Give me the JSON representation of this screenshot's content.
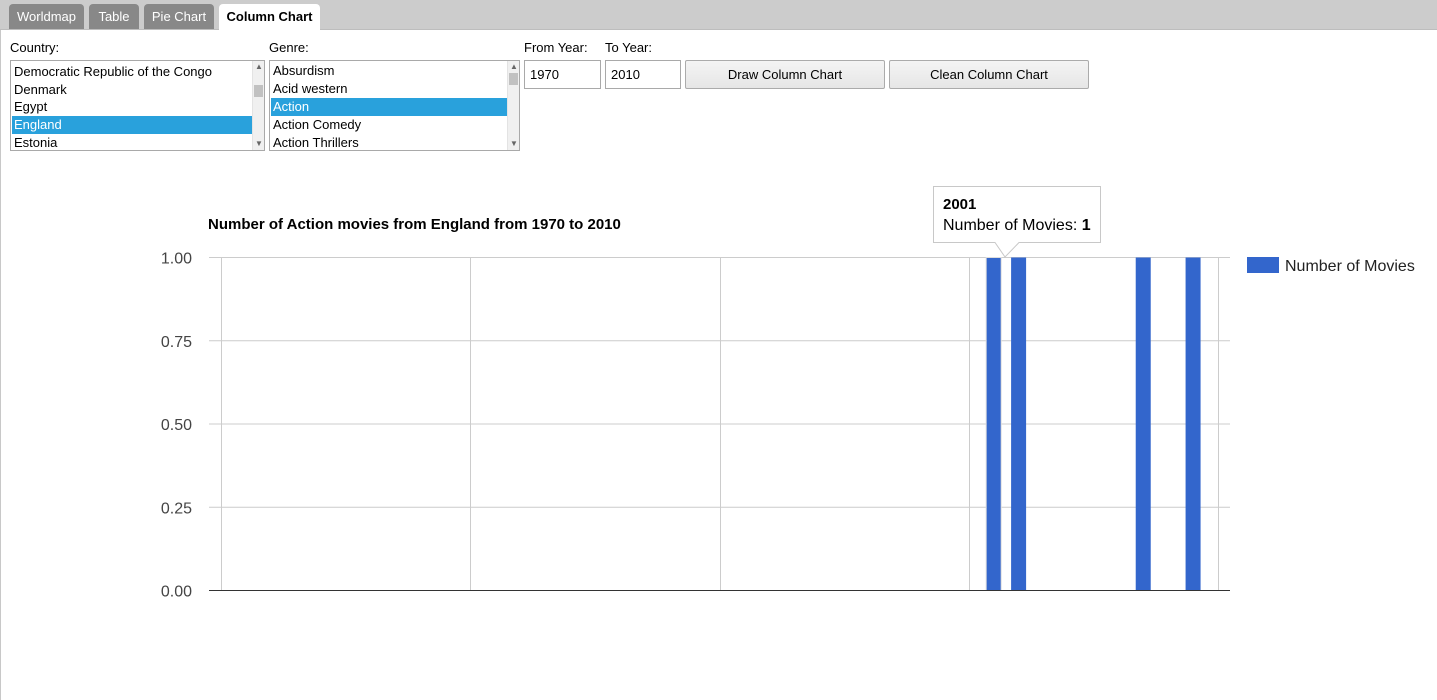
{
  "tabs": [
    {
      "label": "Worldmap",
      "active": false
    },
    {
      "label": "Table",
      "active": false
    },
    {
      "label": "Pie Chart",
      "active": false
    },
    {
      "label": "Column Chart",
      "active": true
    }
  ],
  "form": {
    "country_label": "Country:",
    "genre_label": "Genre:",
    "from_year_label": "From Year:",
    "to_year_label": "To Year:",
    "from_year_value": "1970",
    "to_year_value": "2010",
    "draw_button": "Draw Column Chart",
    "clean_button": "Clean Column Chart",
    "countries": [
      "Democratic Republic of the Congo",
      "Denmark",
      "Egypt",
      "England",
      "Estonia"
    ],
    "country_selected": "England",
    "genres": [
      "Absurdism",
      "Acid western",
      "Action",
      "Action Comedy",
      "Action Thrillers"
    ],
    "genre_selected": "Action"
  },
  "tooltip": {
    "year": "2001",
    "label": "Number of Movies: ",
    "value": "1"
  },
  "colors": {
    "bar": "#3366cc",
    "selected_option": "#29a1dc",
    "tab_bar": "#cccccc",
    "tab_inactive": "#888888"
  },
  "chart_data": {
    "type": "bar",
    "title": "Number of Action movies from England from 1970 to 2010",
    "xlabel": "",
    "ylabel": "",
    "x_range": [
      1970,
      2010
    ],
    "ylim": [
      0,
      1
    ],
    "y_ticks": [
      "0.00",
      "0.25",
      "0.50",
      "0.75",
      "1.00"
    ],
    "grid": true,
    "legend_position": "right",
    "series": [
      {
        "name": "Number of Movies",
        "x": [
          2001,
          2002,
          2007,
          2009
        ],
        "values": [
          1,
          1,
          1,
          1
        ]
      }
    ]
  }
}
